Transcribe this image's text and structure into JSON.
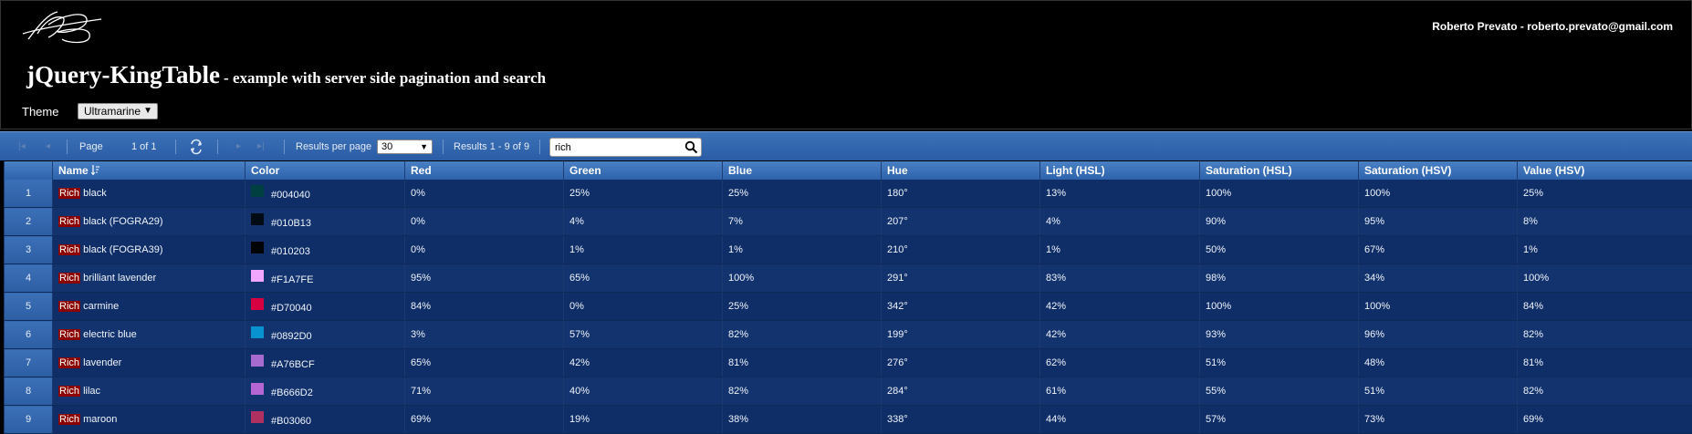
{
  "header": {
    "author": "Roberto Prevato - roberto.prevato@gmail.com",
    "title": "jQuery-KingTable",
    "subtitle": "- example with server side pagination and search",
    "theme_label": "Theme",
    "theme_value": "Ultramarine"
  },
  "toolbar": {
    "page_label": "Page",
    "page_info": "1 of 1",
    "results_per_page_label": "Results per page",
    "results_per_page_value": "30",
    "results_info": "Results 1 - 9 of 9",
    "search_value": "rich",
    "icons": [
      "first-page-icon",
      "prev-page-icon",
      "refresh-icon",
      "next-page-icon",
      "last-page-icon",
      "search-icon"
    ]
  },
  "table": {
    "columns": [
      "Name",
      "Color",
      "Red",
      "Green",
      "Blue",
      "Hue",
      "Light (HSL)",
      "Saturation (HSL)",
      "Saturation (HSV)",
      "Value (HSV)"
    ],
    "highlight": "Rich",
    "rows": [
      {
        "n": "1",
        "prefix": "Rich",
        "name": " black",
        "hex": "#004040",
        "r": "0%",
        "g": "25%",
        "b": "25%",
        "hue": "180°",
        "l": "13%",
        "shsl": "100%",
        "shsv": "100%",
        "v": "25%"
      },
      {
        "n": "2",
        "prefix": "Rich",
        "name": " black (FOGRA29)",
        "hex": "#010B13",
        "r": "0%",
        "g": "4%",
        "b": "7%",
        "hue": "207°",
        "l": "4%",
        "shsl": "90%",
        "shsv": "95%",
        "v": "8%"
      },
      {
        "n": "3",
        "prefix": "Rich",
        "name": " black (FOGRA39)",
        "hex": "#010203",
        "r": "0%",
        "g": "1%",
        "b": "1%",
        "hue": "210°",
        "l": "1%",
        "shsl": "50%",
        "shsv": "67%",
        "v": "1%"
      },
      {
        "n": "4",
        "prefix": "Rich",
        "name": " brilliant lavender",
        "hex": "#F1A7FE",
        "r": "95%",
        "g": "65%",
        "b": "100%",
        "hue": "291°",
        "l": "83%",
        "shsl": "98%",
        "shsv": "34%",
        "v": "100%"
      },
      {
        "n": "5",
        "prefix": "Rich",
        "name": " carmine",
        "hex": "#D70040",
        "r": "84%",
        "g": "0%",
        "b": "25%",
        "hue": "342°",
        "l": "42%",
        "shsl": "100%",
        "shsv": "100%",
        "v": "84%"
      },
      {
        "n": "6",
        "prefix": "Rich",
        "name": " electric blue",
        "hex": "#0892D0",
        "r": "3%",
        "g": "57%",
        "b": "82%",
        "hue": "199°",
        "l": "42%",
        "shsl": "93%",
        "shsv": "96%",
        "v": "82%"
      },
      {
        "n": "7",
        "prefix": "Rich",
        "name": " lavender",
        "hex": "#A76BCF",
        "r": "65%",
        "g": "42%",
        "b": "81%",
        "hue": "276°",
        "l": "62%",
        "shsl": "51%",
        "shsv": "48%",
        "v": "81%"
      },
      {
        "n": "8",
        "prefix": "Rich",
        "name": " lilac",
        "hex": "#B666D2",
        "r": "71%",
        "g": "40%",
        "b": "82%",
        "hue": "284°",
        "l": "61%",
        "shsl": "55%",
        "shsv": "51%",
        "v": "82%"
      },
      {
        "n": "9",
        "prefix": "Rich",
        "name": " maroon",
        "hex": "#B03060",
        "r": "69%",
        "g": "19%",
        "b": "38%",
        "hue": "338°",
        "l": "44%",
        "shsl": "57%",
        "shsv": "73%",
        "v": "69%"
      }
    ]
  }
}
